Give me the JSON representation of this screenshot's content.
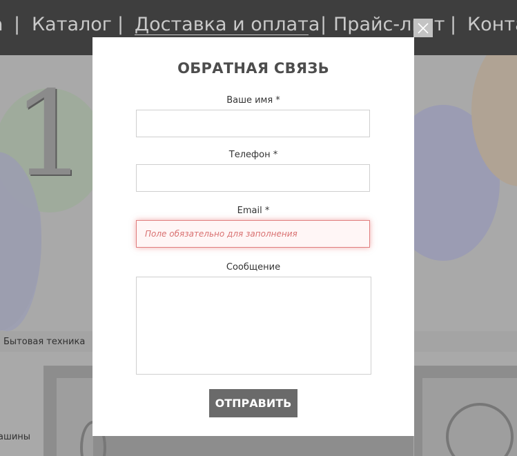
{
  "nav": {
    "items": [
      "а",
      "Каталог",
      "Доставка и оплата",
      "Прайс-лист",
      "Конта"
    ],
    "separator": "|"
  },
  "background": {
    "big_number": "1",
    "category_text": "Бытовая техника",
    "side_text_1": "ашины"
  },
  "modal": {
    "title": "ОБРАТНАЯ СВЯЗЬ",
    "close_icon": "close-icon",
    "fields": {
      "name_label": "Ваше имя *",
      "name_value": "",
      "phone_label": "Телефон *",
      "phone_value": "",
      "email_label": "Email *",
      "email_placeholder": "Поле обязательно для заполнения",
      "email_value": "",
      "message_label": "Сообщение",
      "message_value": ""
    },
    "submit_label": "ОТПРАВИТЬ"
  },
  "colors": {
    "nav_bg": "#3e3e3e",
    "error": "#e07d7d",
    "submit_bg": "#6a6a6a",
    "title": "#4d4d4d"
  }
}
